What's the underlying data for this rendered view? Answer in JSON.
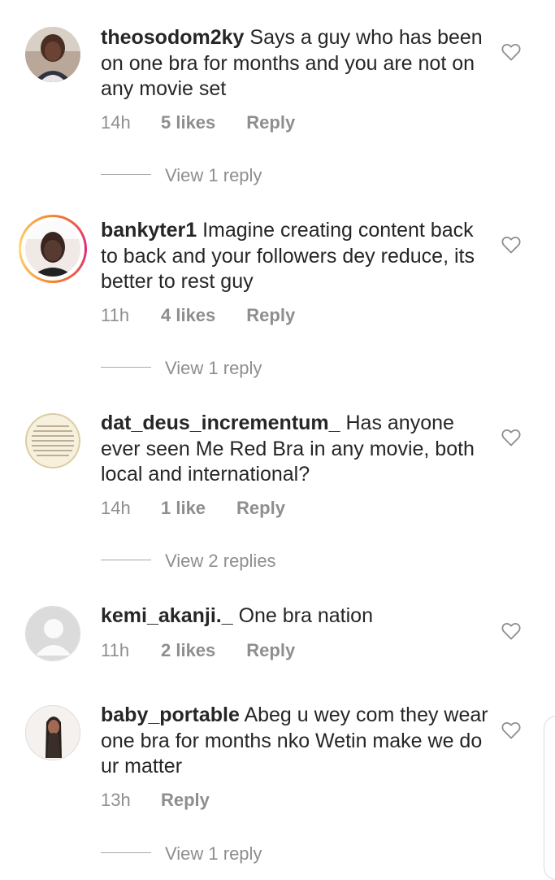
{
  "comments": [
    {
      "username": "theosodom2ky",
      "text": "Says a guy who has been on one bra for months and you are not on any movie set",
      "time": "14h",
      "likes": "5 likes",
      "reply_label": "Reply",
      "view_replies": "View 1 reply",
      "avatar_icon": "user-photo-avatar",
      "has_story_ring": false
    },
    {
      "username": "bankyter1",
      "text": "Imagine creating content back to back and your followers dey reduce, its better to rest guy",
      "time": "11h",
      "likes": "4 likes",
      "reply_label": "Reply",
      "view_replies": "View 1 reply",
      "avatar_icon": "user-photo-avatar",
      "has_story_ring": true
    },
    {
      "username": "dat_deus_incrementum_",
      "text": "Has anyone ever seen Me Red Bra in any movie, both local and international?",
      "time": "14h",
      "likes": "1 like",
      "reply_label": "Reply",
      "view_replies": "View 2 replies",
      "avatar_icon": "text-image-avatar",
      "has_story_ring": false
    },
    {
      "username": "kemi_akanji._",
      "text": "One bra nation",
      "time": "11h",
      "likes": "2 likes",
      "reply_label": "Reply",
      "view_replies": "",
      "avatar_icon": "default-user-avatar",
      "has_story_ring": false
    },
    {
      "username": "baby_portable",
      "text": "Abeg u wey com they wear one bra for  months nko Wetin make we do ur matter",
      "time": "13h",
      "likes": "",
      "reply_label": "Reply",
      "view_replies": "View 1 reply",
      "avatar_icon": "user-photo-avatar",
      "has_story_ring": false
    }
  ],
  "colors": {
    "text": "#262626",
    "secondary": "#8e8e8e",
    "divider": "#a8a8a8",
    "story_ring_start": "#f58529",
    "story_ring_end": "#dd2a7b"
  },
  "icons": {
    "like": "heart-outline-icon"
  }
}
